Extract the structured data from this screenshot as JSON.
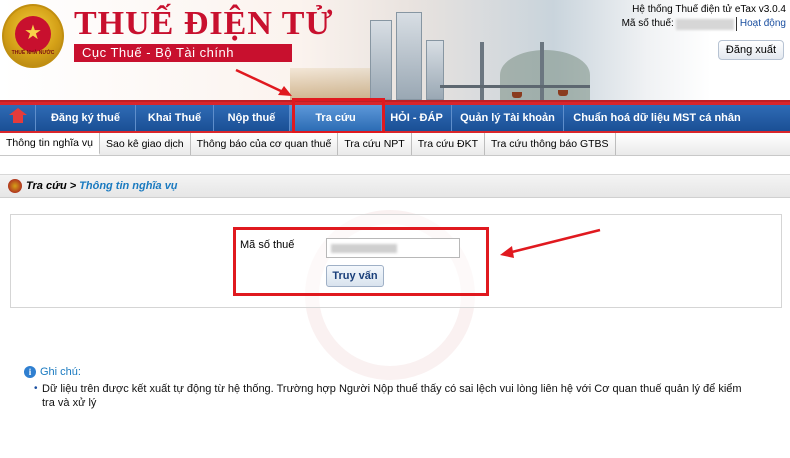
{
  "header": {
    "system_name": "Hệ thống Thuế điện tử eTax v3.0.4",
    "tax_code_label": "Mã số thuế:",
    "activity_link": "Hoạt động",
    "logout_label": "Đăng xuất",
    "site_title": "THUẾ ĐIỆN TỬ",
    "site_subtitle": "Cục Thuế - Bộ Tài chính",
    "emblem_text": "THUẾ NHÀ NƯỚC"
  },
  "nav": {
    "home_icon": "home-icon",
    "items": [
      {
        "label": "Đăng ký thuế"
      },
      {
        "label": "Khai Thuế"
      },
      {
        "label": "Nộp thuế"
      },
      {
        "label": "Tra cứu",
        "active": true
      },
      {
        "label": "HỎI - ĐÁP"
      },
      {
        "label": "Quản lý Tài khoản"
      },
      {
        "label": "Chuẩn hoá dữ liệu MST cá nhân"
      }
    ]
  },
  "subnav": {
    "items": [
      {
        "label": "Thông tin nghĩa vụ",
        "active": true
      },
      {
        "label": "Sao kê giao dịch"
      },
      {
        "label": "Thông báo của cơ quan thuế"
      },
      {
        "label": "Tra cứu NPT"
      },
      {
        "label": "Tra cứu ĐKT"
      },
      {
        "label": "Tra cứu thông báo GTBS"
      }
    ]
  },
  "breadcrumb": {
    "parent": "Tra cứu >",
    "current": "Thông tin nghĩa vụ"
  },
  "form": {
    "tax_code_label": "Mã số thuế",
    "query_button": "Truy vấn"
  },
  "note": {
    "title": "Ghi chú:",
    "text": "Dữ liệu trên được kết xuất tự động từ hệ thống. Trường hợp Người Nộp thuế thấy có sai lệch vui lòng liên hệ với Cơ quan thuế quản lý để kiểm tra và xử lý"
  },
  "colors": {
    "brand_red": "#c8102e",
    "nav_blue": "#1a4f95",
    "link_blue": "#1a7ac0",
    "highlight_red": "#e0191f"
  }
}
